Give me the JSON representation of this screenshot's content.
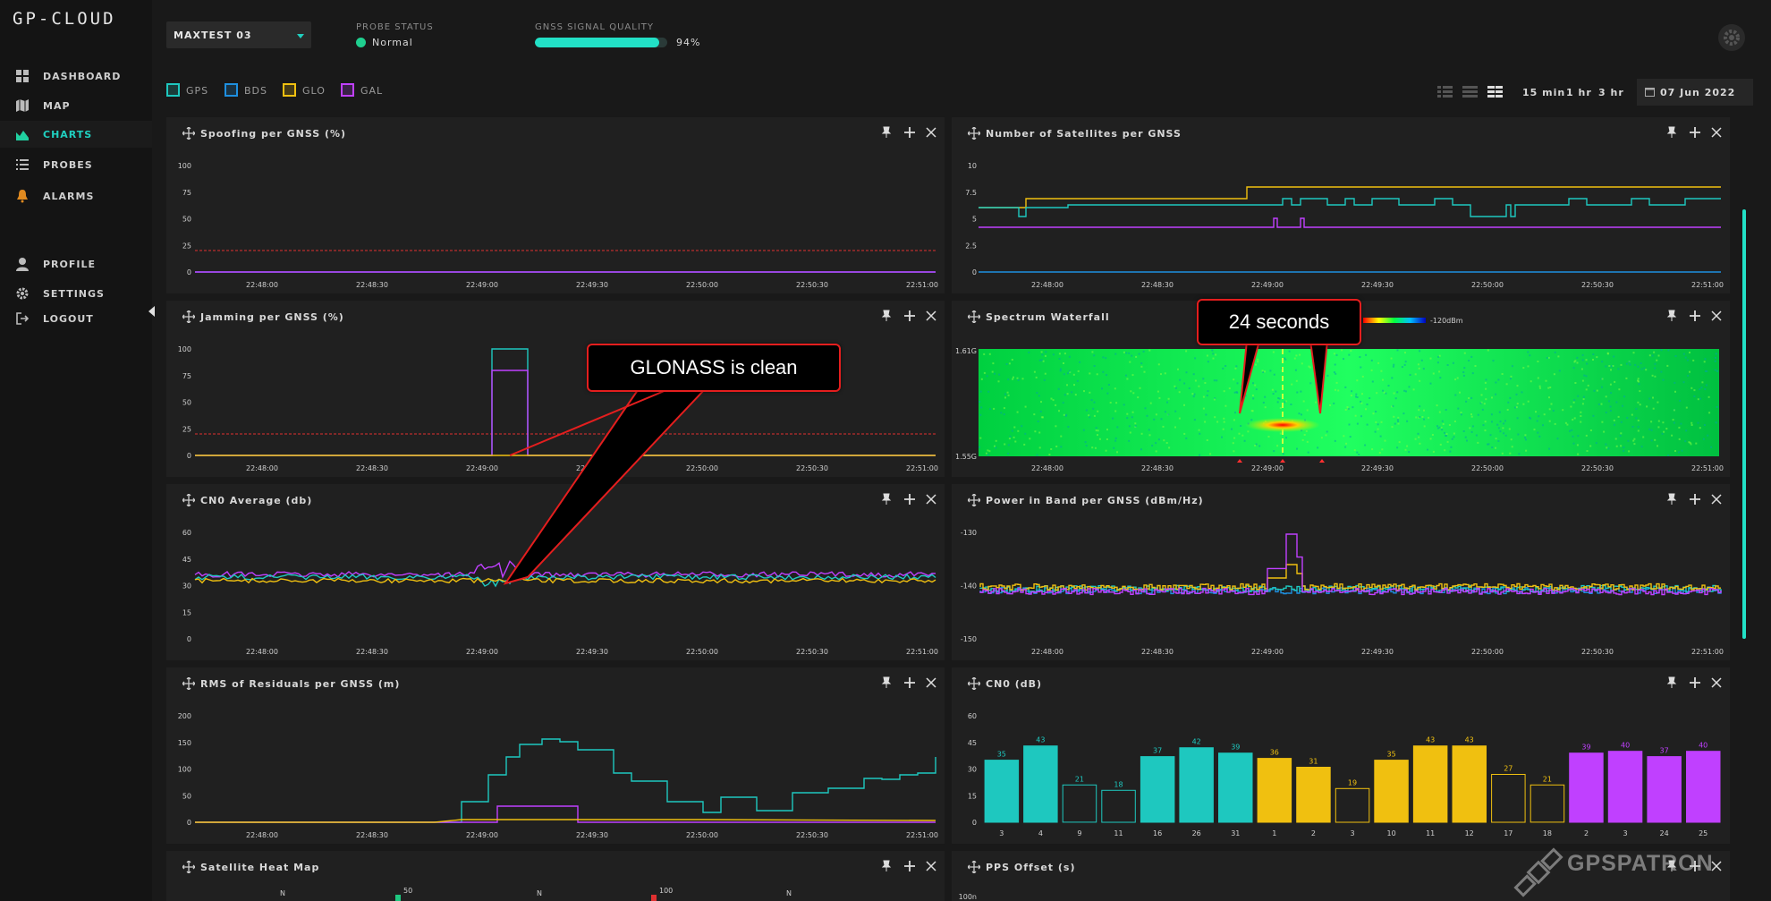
{
  "app": {
    "logo": "GP-CLOUD"
  },
  "nav": [
    {
      "label": "DASHBOARD",
      "icon": "grid-icon",
      "active": false
    },
    {
      "label": "MAP",
      "icon": "map-icon",
      "active": false
    },
    {
      "label": "CHARTS",
      "icon": "area-chart-icon",
      "active": true
    },
    {
      "label": "PROBES",
      "icon": "list-icon",
      "active": false
    },
    {
      "label": "ALARMS",
      "icon": "bell-icon",
      "active": false
    },
    {
      "label": "PROFILE",
      "icon": "user-icon",
      "active": false
    },
    {
      "label": "SETTINGS",
      "icon": "gear-icon",
      "active": false
    },
    {
      "label": "LOGOUT",
      "icon": "logout-icon",
      "active": false
    }
  ],
  "header": {
    "probe": "MAXTEST 03",
    "probe_status_label": "PROBE STATUS",
    "probe_status_value": "Normal",
    "signal_label": "GNSS SIGNAL QUALITY",
    "signal_value": "94%",
    "signal_fraction": 0.94
  },
  "legend": [
    {
      "label": "GPS",
      "color": "#1ec8bf"
    },
    {
      "label": "BDS",
      "color": "#1e8fe0"
    },
    {
      "label": "GLO",
      "color": "#f0c010"
    },
    {
      "label": "GAL",
      "color": "#c040ff"
    }
  ],
  "toolbar": {
    "ranges": [
      "15 min",
      "1 hr",
      "3 hr"
    ],
    "date": "07 Jun 2022"
  },
  "time_ticks": [
    "22:48:00",
    "22:48:30",
    "22:49:00",
    "22:49:30",
    "22:50:00",
    "22:50:30",
    "22:51:00"
  ],
  "time_ticks_right": [
    "22:48:00",
    "22:48:30",
    "22:49:00",
    "22:49:30",
    "22:50:00",
    "22:50:30",
    "22:51:00"
  ],
  "panels": {
    "spoofing": {
      "title": "Spoofing per GNSS (%)",
      "yticks": [
        "100",
        "75",
        "50",
        "25",
        "0"
      ]
    },
    "satellites": {
      "title": "Number of Satellites per GNSS",
      "yticks": [
        "10",
        "7.5",
        "5",
        "2.5",
        "0"
      ]
    },
    "jamming": {
      "title": "Jamming per GNSS (%)",
      "yticks": [
        "100",
        "75",
        "50",
        "25",
        "0"
      ]
    },
    "waterfall": {
      "title": "Spectrum Waterfall",
      "scale_label": "-120dBm",
      "y_top": "1.61G",
      "y_bottom": "1.55G"
    },
    "cn0avg": {
      "title": "CN0 Average (db)",
      "yticks": [
        "60",
        "45",
        "30",
        "15",
        "0"
      ]
    },
    "power": {
      "title": "Power in Band per GNSS (dBm/Hz)",
      "yticks": [
        "-130",
        "-140",
        "-150"
      ]
    },
    "rms": {
      "title": "RMS of Residuals per GNSS (m)",
      "yticks": [
        "200",
        "150",
        "100",
        "50",
        "0"
      ]
    },
    "cn0": {
      "title": "CN0 (dB)",
      "yticks": [
        "60",
        "45",
        "30",
        "15",
        "0"
      ]
    },
    "heatmap": {
      "title": "Satellite Heat Map",
      "labels": [
        "N",
        "N",
        "N"
      ],
      "scale": [
        "50",
        "100"
      ]
    },
    "pps": {
      "title": "PPS Offset (s)",
      "ytick": "100n"
    }
  },
  "chart_data": [
    {
      "type": "bar",
      "title": "CN0 (dB)",
      "ylim": [
        0,
        60
      ],
      "categories": [
        "3",
        "4",
        "9",
        "11",
        "16",
        "26",
        "31",
        "1",
        "2",
        "3",
        "10",
        "11",
        "12",
        "17",
        "18",
        "2",
        "3",
        "24",
        "25"
      ],
      "series": [
        {
          "values": [
            35,
            43,
            21,
            18,
            37,
            42,
            39,
            36,
            31,
            19,
            35,
            43,
            43,
            27,
            21,
            39,
            40,
            37,
            40
          ]
        }
      ],
      "colors": [
        "#1ec8bf",
        "#1ec8bf",
        "#1ec8bf",
        "#1ec8bf",
        "#1ec8bf",
        "#1ec8bf",
        "#1ec8bf",
        "#f0c010",
        "#f0c010",
        "#f0c010",
        "#f0c010",
        "#f0c010",
        "#f0c010",
        "#f0c010",
        "#f0c010",
        "#c040ff",
        "#c040ff",
        "#c040ff",
        "#c040ff"
      ],
      "filled": [
        true,
        true,
        false,
        false,
        true,
        true,
        true,
        true,
        true,
        false,
        true,
        true,
        true,
        false,
        false,
        true,
        true,
        true,
        true
      ]
    }
  ],
  "callouts": {
    "glonass": "GLONASS is clean",
    "seconds": "24 seconds"
  },
  "watermark": "GPSPATRON"
}
